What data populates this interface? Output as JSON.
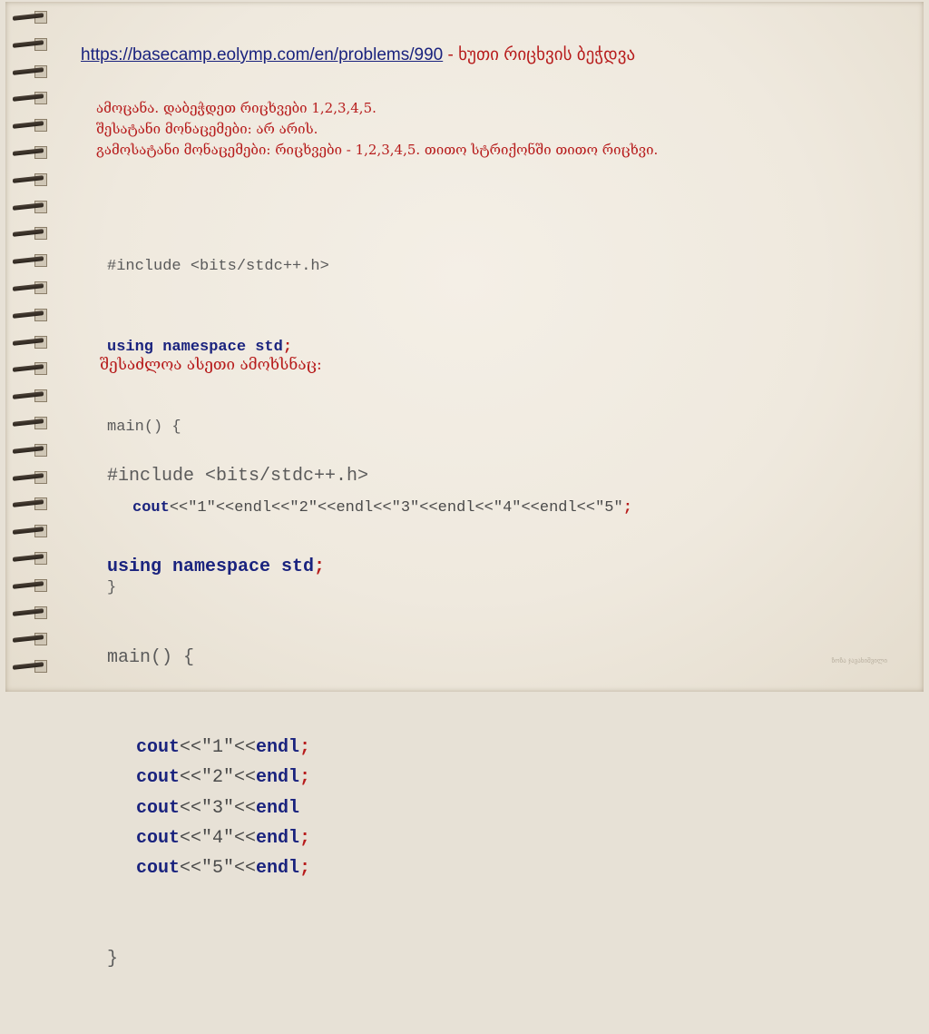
{
  "header": {
    "link_text": "https://basecamp.eolymp.com/en/problems/990",
    "separator": " - ",
    "title": "ხუთი რიცხვის ბეჭდვა"
  },
  "problem": {
    "line1": "ამოცანა. დაბეჭდეთ რიცხვები 1,2,3,4,5.",
    "line2": "შესატანი მონაცემები: არ არის.",
    "line3": "გამოსატანი მონაცემები: რიცხვები - 1,2,3,4,5. თითო სტრიქონში თითო რიცხვი."
  },
  "code1": {
    "include": "#include <bits/stdc++.h>",
    "using_kw": "using namespace std",
    "main_name": "main",
    "main_rest": "() {",
    "cout": "cout",
    "stream": "<<\"1\"<<endl<<\"2\"<<endl<<\"3\"<<endl<<\"4\"<<endl<<\"5\"",
    "close": "}"
  },
  "explain": "შესაძლოა ასეთი ამოხსნაც:",
  "code2": {
    "include": "#include <bits/stdc++.h>",
    "using_kw": "using namespace std",
    "main_name": "main",
    "main_rest": "() {",
    "lines": [
      {
        "cout": "cout",
        "rest": "<<\"1\"<<",
        "endl": "endl",
        "semi": ";"
      },
      {
        "cout": "cout",
        "rest": "<<\"2\"<<",
        "endl": "endl",
        "semi": ";"
      },
      {
        "cout": "cout",
        "rest": "<<\"3\"<<",
        "endl": "endl",
        "semi": ""
      },
      {
        "cout": "cout",
        "rest": "<<\"4\"<<",
        "endl": "endl",
        "semi": ";"
      },
      {
        "cout": "cout",
        "rest": "<<\"5\"<<",
        "endl": "endl",
        "semi": ";"
      }
    ],
    "close": "}"
  },
  "stamp": "ზოზა ჯავახიშვილი"
}
